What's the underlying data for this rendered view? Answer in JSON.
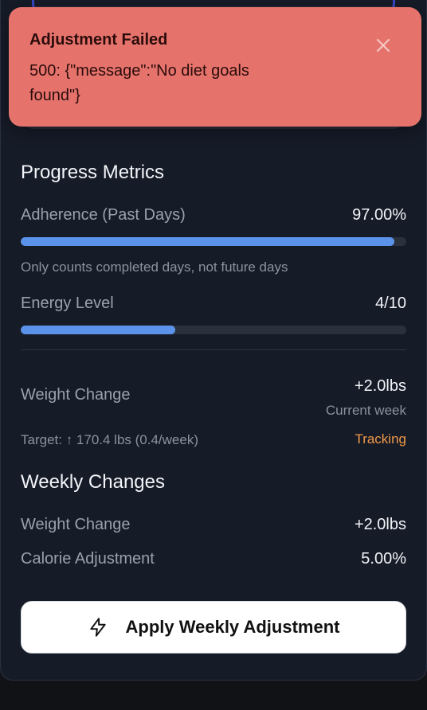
{
  "toast": {
    "title": "Adjustment Failed",
    "message": "500: {\"message\":\"No diet goals found\"}",
    "close_icon": "close-icon",
    "background": "#e5736c"
  },
  "progress_metrics": {
    "heading": "Progress Metrics",
    "adherence": {
      "label": "Adherence (Past Days)",
      "value": "97.00%",
      "fraction": 0.97
    },
    "adherence_note": "Only counts completed days, not future days",
    "energy": {
      "label": "Energy Level",
      "value": "4/10",
      "fraction": 0.4
    },
    "weight_change": {
      "label": "Weight Change",
      "value": "+2.0lbs",
      "period": "Current week",
      "target": "Target: ↑ 170.4 lbs (0.4/week)",
      "status": "Tracking",
      "status_color": "#f2994a"
    }
  },
  "weekly_changes": {
    "heading": "Weekly Changes",
    "weight_change": {
      "label": "Weight Change",
      "value": "+2.0lbs"
    },
    "calorie_adjustment": {
      "label": "Calorie Adjustment",
      "value": "5.00%"
    }
  },
  "actions": {
    "apply_label": "Apply Weekly Adjustment",
    "apply_icon": "lightning-bolt-icon"
  },
  "colors": {
    "accent": "#5b93ea",
    "card_bg": "#151b27",
    "tracking": "#f2994a"
  }
}
